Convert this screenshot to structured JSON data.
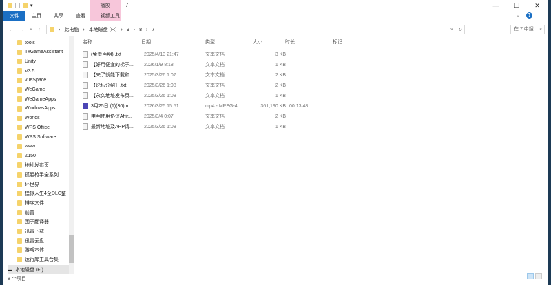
{
  "window": {
    "title": "7",
    "context_tab": "播放",
    "controls": [
      "—",
      "☐",
      "✕"
    ]
  },
  "ribbon": {
    "tabs": [
      "文件",
      "主页",
      "共享",
      "查看",
      "视频工具"
    ],
    "help": "?"
  },
  "address": {
    "path": [
      "此电脑",
      "本地磁盘 (F:)",
      "9",
      "8",
      "7"
    ],
    "search_placeholder": "在 7 中搜..."
  },
  "nav_pane": {
    "items": [
      "tools",
      "TxGameAssistant",
      "Unity",
      "V3.5",
      "vueSpace",
      "WeGame",
      "WeGameApps",
      "WindowsApps",
      "Worlds",
      "WPS Office",
      "WPS Software",
      "www",
      "Z150",
      "地址发布页",
      "孤胆枪手全系列",
      "环世界",
      "模拟人生4全DLC整",
      "排序文件",
      "前置",
      "团子翻译器",
      "迅雷下载",
      "迅雷云盘",
      "游戏本体",
      "运行库工具合集"
    ],
    "drive": "本地磁盘 (F:)"
  },
  "columns": [
    "名称",
    "日期",
    "类型",
    "大小",
    "时长",
    "标记"
  ],
  "files": [
    {
      "name": "(免责声明) .txt",
      "date": "2025/4/13 21:47",
      "type": "文本文档",
      "size": "3 KB",
      "duration": "",
      "icon": "text"
    },
    {
      "name": "【好用便宜的梯子...",
      "date": "2026/1/9 8:18",
      "type": "文本文档",
      "size": "1 KB",
      "duration": "",
      "icon": "text"
    },
    {
      "name": "【来了就能下载和...",
      "date": "2025/3/26 1:07",
      "type": "文本文档",
      "size": "2 KB",
      "duration": "",
      "icon": "text"
    },
    {
      "name": "【论坛介绍】.txt",
      "date": "2025/3/26 1:08",
      "type": "文本文档",
      "size": "2 KB",
      "duration": "",
      "icon": "text"
    },
    {
      "name": "【永久地址发布页...",
      "date": "2025/3/26 1:08",
      "type": "文本文档",
      "size": "1 KB",
      "duration": "",
      "icon": "text"
    },
    {
      "name": "3月25日 (1)(30).m...",
      "date": "2026/3/25 15:51",
      "type": "mp4 - MPEG-4 ...",
      "size": "361,190 KB",
      "duration": "00:13:48",
      "icon": "video"
    },
    {
      "name": "申明使用协议Affir...",
      "date": "2025/3/4 0:07",
      "type": "文本文档",
      "size": "2 KB",
      "duration": "",
      "icon": "text"
    },
    {
      "name": "最新地址及APP请...",
      "date": "2025/3/26 1:08",
      "type": "文本文档",
      "size": "1 KB",
      "duration": "",
      "icon": "text"
    }
  ],
  "status": {
    "count": "8 个项目"
  }
}
